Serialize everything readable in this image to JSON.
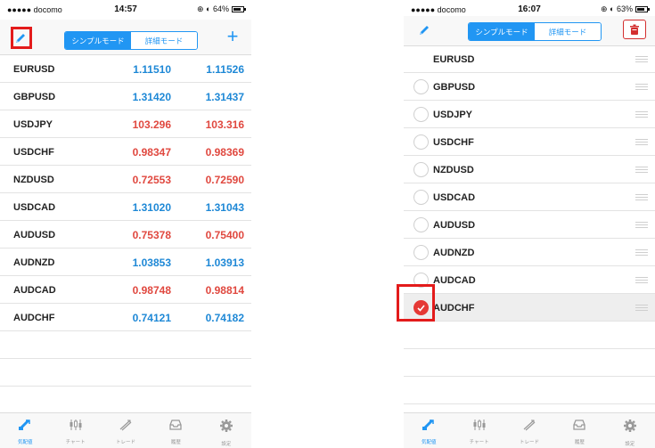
{
  "colors": {
    "accent": "#2196f3",
    "up": "#1e88d6",
    "down": "#e0483f",
    "danger": "#e53935",
    "highlight": "#e31b1b"
  },
  "left_screen": {
    "status": {
      "carrier": "●●●●● docomo ⁠",
      "time": "14:57",
      "battery": "⊕ ◐ 64%"
    },
    "nav": {
      "edit_icon": "pencil-icon",
      "mode_simple": "シンプルモード",
      "mode_detail": "詳細モード",
      "add_label": "+"
    },
    "quotes": [
      {
        "symbol": "EURUSD",
        "bid": "1.11510",
        "ask": "1.11526",
        "dir": "up"
      },
      {
        "symbol": "GBPUSD",
        "bid": "1.31420",
        "ask": "1.31437",
        "dir": "up"
      },
      {
        "symbol": "USDJPY",
        "bid": "103.296",
        "ask": "103.316",
        "dir": "down"
      },
      {
        "symbol": "USDCHF",
        "bid": "0.98347",
        "ask": "0.98369",
        "dir": "down"
      },
      {
        "symbol": "NZDUSD",
        "bid": "0.72553",
        "ask": "0.72590",
        "dir": "down"
      },
      {
        "symbol": "USDCAD",
        "bid": "1.31020",
        "ask": "1.31043",
        "dir": "up"
      },
      {
        "symbol": "AUDUSD",
        "bid": "0.75378",
        "ask": "0.75400",
        "dir": "down"
      },
      {
        "symbol": "AUDNZD",
        "bid": "1.03853",
        "ask": "1.03913",
        "dir": "up"
      },
      {
        "symbol": "AUDCAD",
        "bid": "0.98748",
        "ask": "0.98814",
        "dir": "down"
      },
      {
        "symbol": "AUDCHF",
        "bid": "0.74121",
        "ask": "0.74182",
        "dir": "up"
      }
    ]
  },
  "right_screen": {
    "status": {
      "carrier": "●●●●● docomo ⁠",
      "time": "16:07",
      "battery": "⊕ ◐ 63%"
    },
    "nav": {
      "edit_icon": "pencil-icon",
      "mode_simple": "シンプルモード",
      "mode_detail": "詳細モード",
      "delete_icon": "trash-icon"
    },
    "edit_rows": [
      {
        "symbol": "EURUSD",
        "selected": false,
        "radio": false
      },
      {
        "symbol": "GBPUSD",
        "selected": false,
        "radio": true
      },
      {
        "symbol": "USDJPY",
        "selected": false,
        "radio": true
      },
      {
        "symbol": "USDCHF",
        "selected": false,
        "radio": true
      },
      {
        "symbol": "NZDUSD",
        "selected": false,
        "radio": true
      },
      {
        "symbol": "USDCAD",
        "selected": false,
        "radio": true
      },
      {
        "symbol": "AUDUSD",
        "selected": false,
        "radio": true
      },
      {
        "symbol": "AUDNZD",
        "selected": false,
        "radio": true
      },
      {
        "symbol": "AUDCAD",
        "selected": false,
        "radio": true
      },
      {
        "symbol": "AUDCHF",
        "selected": true,
        "radio": true
      }
    ]
  },
  "tabbar": [
    {
      "label": "気配値",
      "icon": "quotes-icon",
      "active": true
    },
    {
      "label": "チャート",
      "icon": "chart-icon",
      "active": false
    },
    {
      "label": "トレード",
      "icon": "trade-icon",
      "active": false
    },
    {
      "label": "履歴",
      "icon": "history-icon",
      "active": false
    },
    {
      "label": "設定",
      "icon": "settings-icon",
      "active": false
    }
  ]
}
